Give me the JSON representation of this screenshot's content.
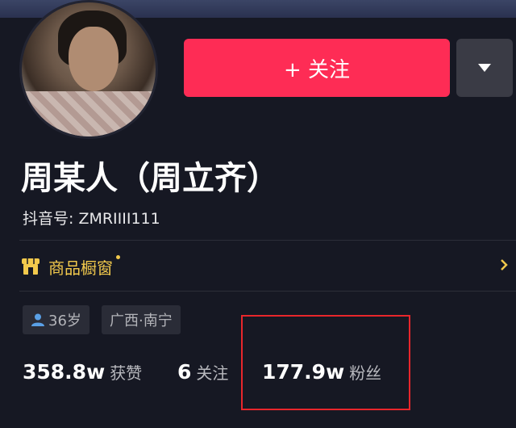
{
  "profile": {
    "name": "周某人（周立齐）",
    "douyin_id": "抖音号: ZMRIIII111",
    "avatar_icon": "avatar-photo"
  },
  "actions": {
    "follow_label": "+ 关注",
    "more_icon": "caret-down-icon"
  },
  "showcase": {
    "label": "商品橱窗",
    "icon": "shop-icon",
    "chevron_icon": "chevron-right-icon"
  },
  "tags": {
    "age": "36岁",
    "location": "广西·南宁"
  },
  "stats": {
    "likes": {
      "value": "358.8w",
      "label": "获赞"
    },
    "following": {
      "value": "6",
      "label": "关注"
    },
    "followers": {
      "value": "177.9w",
      "label": "粉丝"
    }
  },
  "colors": {
    "background": "#161823",
    "follow_button": "#fe2c55",
    "showcase_text": "#f2c94c",
    "highlight_box": "#e8262b"
  }
}
